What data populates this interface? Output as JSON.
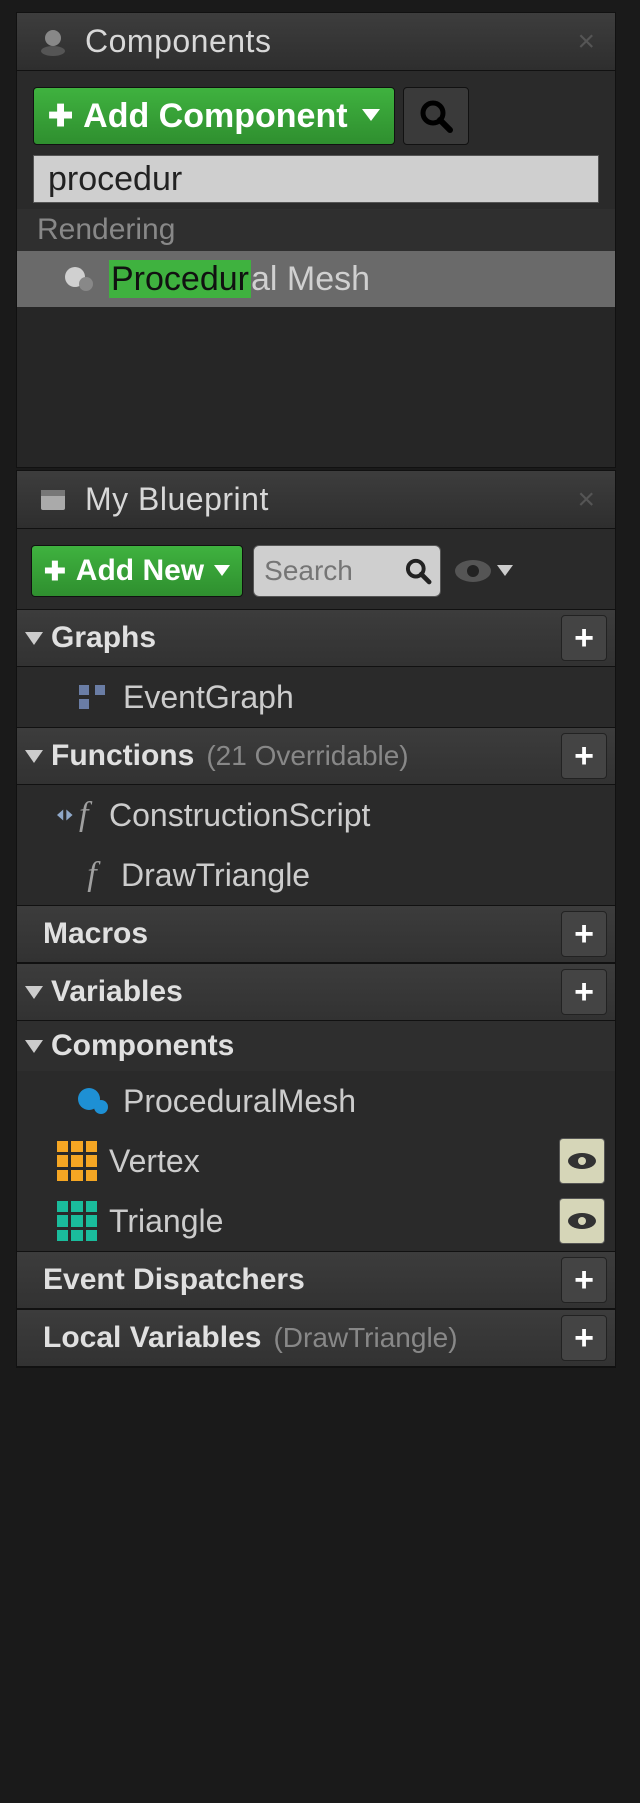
{
  "panel1": {
    "title": "Components",
    "addBtn": "Add Component",
    "searchValue": "procedur",
    "category": "Rendering",
    "resultHighlight": "Procedur",
    "resultRest": "al Mesh"
  },
  "panel2": {
    "title": "My Blueprint",
    "addBtn": "Add New",
    "searchPlaceholder": "Search",
    "sections": {
      "graphs": {
        "title": "Graphs"
      },
      "functions": {
        "title": "Functions",
        "sub": "(21 Overridable)"
      },
      "macros": {
        "title": "Macros"
      },
      "variables": {
        "title": "Variables"
      },
      "components": {
        "title": "Components"
      },
      "event": {
        "title": "Event Dispatchers"
      },
      "local": {
        "title": "Local Variables",
        "sub": "(DrawTriangle)"
      }
    },
    "items": {
      "eventGraph": "EventGraph",
      "constructionScript": "ConstructionScript",
      "drawTriangle": "DrawTriangle",
      "proceduralMesh": "ProceduralMesh",
      "vertex": "Vertex",
      "triangle": "Triangle"
    }
  },
  "colors": {
    "green": "#3fb23f"
  }
}
